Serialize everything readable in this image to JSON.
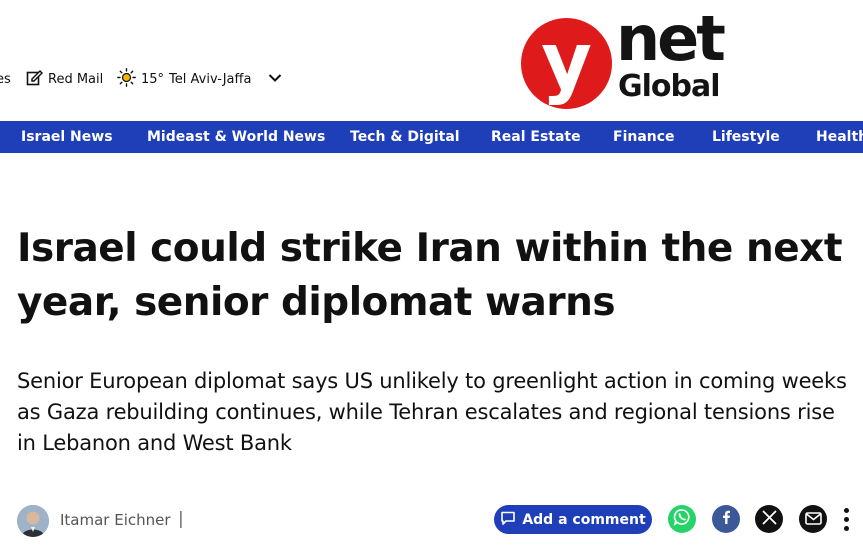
{
  "header": {
    "truncated_link": "es",
    "mail_label": "Red Mail",
    "weather": {
      "temp": "15°",
      "city": "Tel Aviv-Jaffa"
    },
    "logo": {
      "letter": "y",
      "word": "net",
      "sub": "Global",
      "brand_red": "#de1a1a"
    }
  },
  "nav": {
    "color": "#1f3fb8",
    "items": [
      "Israel News",
      "Mideast & World News",
      "Tech & Digital",
      "Real Estate",
      "Finance",
      "Lifestyle",
      "Health"
    ]
  },
  "article": {
    "headline": "Israel could strike Iran within the next year, senior diplomat warns",
    "subheadline": "Senior European diplomat says US unlikely to greenlight action in coming weeks as Gaza rebuilding continues, while Tehran escalates and regional tensions rise in Lebanon and West Bank"
  },
  "byline": {
    "author": "Itamar Eichner",
    "separator": "|",
    "comment_label": "Add a comment",
    "share_icons": [
      "whatsapp-icon",
      "facebook-icon",
      "x-icon",
      "mail-icon",
      "more-icon"
    ]
  }
}
